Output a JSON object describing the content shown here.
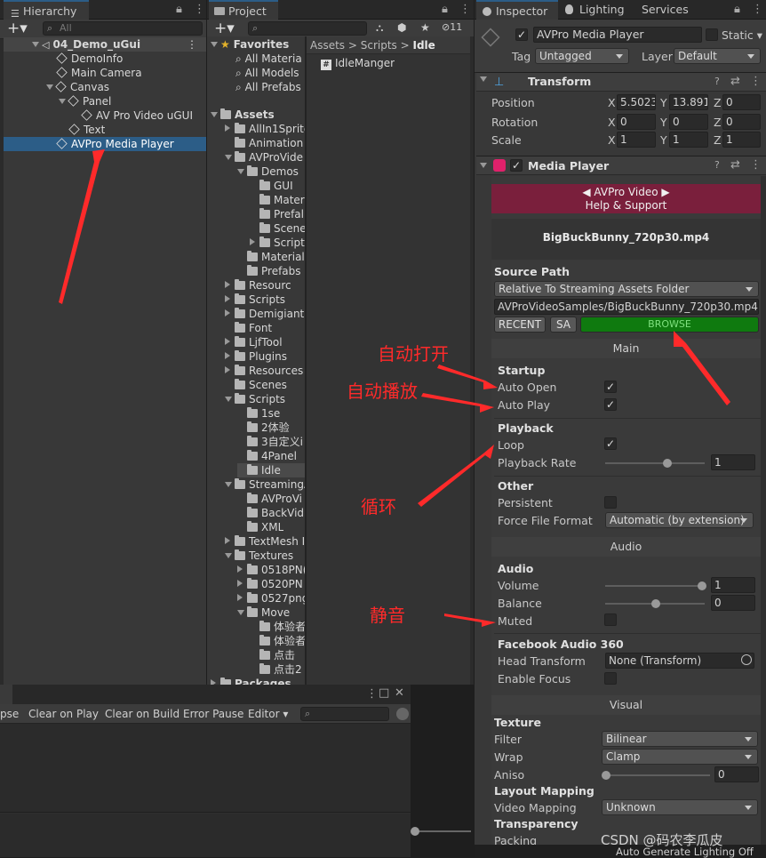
{
  "hierarchy": {
    "tab": "Hierarchy",
    "search_placeholder": "All",
    "scene": "04_Demo_uGui",
    "items": [
      "DemoInfo",
      "Main Camera",
      "Canvas",
      "Panel",
      "AV Pro Video uGUI",
      "Text",
      "AVPro Media Player"
    ]
  },
  "project": {
    "tab": "Project",
    "badge": "11",
    "favorites": {
      "label": "Favorites",
      "items": [
        "All Materia",
        "All Models",
        "All Prefabs"
      ]
    },
    "assets_label": "Assets",
    "tree": [
      "AllIn1Sprite",
      "Animation",
      "AVProVide",
      "Demos",
      "GUI",
      "Mater",
      "Prefal",
      "Scene",
      "Script",
      "Material",
      "Prefabs",
      "Resourc",
      "Scripts",
      "Demigiant",
      "Font",
      "LjfTool",
      "Plugins",
      "Resources",
      "Scenes",
      "Scripts",
      "1se",
      "2体验",
      "3自定义i",
      "4Panel",
      "Idle",
      "StreamingA",
      "AVProVi",
      "BackVid",
      "XML",
      "TextMesh I",
      "Textures",
      "0518PN(",
      "0520PN",
      "0527png",
      "Move",
      "体验者",
      "体验者",
      "点击",
      "点击2",
      "Packages"
    ],
    "breadcrumb": [
      "Assets",
      "Scripts",
      "Idle"
    ],
    "file": "IdleManger"
  },
  "console": {
    "buttons": [
      "pse",
      "Clear on Play",
      "Clear on Build",
      "Error Pause",
      "Editor"
    ]
  },
  "inspector": {
    "tabs": [
      "Inspector",
      "Lighting",
      "Services"
    ],
    "object_name": "AVPro Media Player",
    "static_label": "Static",
    "tag_label": "Tag",
    "tag_value": "Untagged",
    "layer_label": "Layer",
    "layer_value": "Default",
    "transform": {
      "title": "Transform",
      "position": {
        "label": "Position",
        "x": "5.5023",
        "y": "13.891",
        "z": "0"
      },
      "rotation": {
        "label": "Rotation",
        "x": "0",
        "y": "0",
        "z": "0"
      },
      "scale": {
        "label": "Scale",
        "x": "1",
        "y": "1",
        "z": "1"
      }
    },
    "media_player": {
      "title": "Media Player",
      "banner_line1": "◀ AVPro Video ▶",
      "banner_line2": "Help & Support",
      "video_name": "BigBuckBunny_720p30.mp4",
      "source_path_label": "Source Path",
      "source_mode": "Relative To Streaming Assets Folder",
      "path": "AVProVideoSamples/BigBuckBunny_720p30.mp4",
      "recent": "RECENT",
      "sa": "SA",
      "browse": "BROWSE",
      "main_header": "Main",
      "startup": "Startup",
      "auto_open": "Auto Open",
      "auto_play": "Auto Play",
      "playback": "Playback",
      "loop": "Loop",
      "playback_rate": "Playback Rate",
      "playback_rate_value": "1",
      "other": "Other",
      "persistent": "Persistent",
      "force_file_format": "Force File Format",
      "force_file_format_value": "Automatic (by extension)",
      "audio_header": "Audio",
      "audio": "Audio",
      "volume": "Volume",
      "volume_value": "1",
      "balance": "Balance",
      "balance_value": "0",
      "muted": "Muted",
      "fb_audio": "Facebook Audio 360",
      "head_transform": "Head Transform",
      "head_transform_value": "None (Transform)",
      "enable_focus": "Enable Focus",
      "visual_header": "Visual",
      "texture": "Texture",
      "filter": "Filter",
      "filter_value": "Bilinear",
      "wrap": "Wrap",
      "wrap_value": "Clamp",
      "aniso": "Aniso",
      "aniso_value": "0",
      "layout_mapping": "Layout Mapping",
      "video_mapping": "Video Mapping",
      "video_mapping_value": "Unknown",
      "transparency": "Transparency",
      "packing": "Packing"
    }
  },
  "annotations": {
    "auto_open": "自动打开",
    "auto_play": "自动播放",
    "loop": "循环",
    "muted": "静音"
  },
  "watermark": "CSDN @码农李瓜皮",
  "status_bar": "Auto Generate Lighting Off",
  "colors": {
    "selection": "#2c5d87",
    "browse": "#0f7a0f",
    "banner": "#7a1f3c",
    "annotation": "#ff2a2a"
  }
}
